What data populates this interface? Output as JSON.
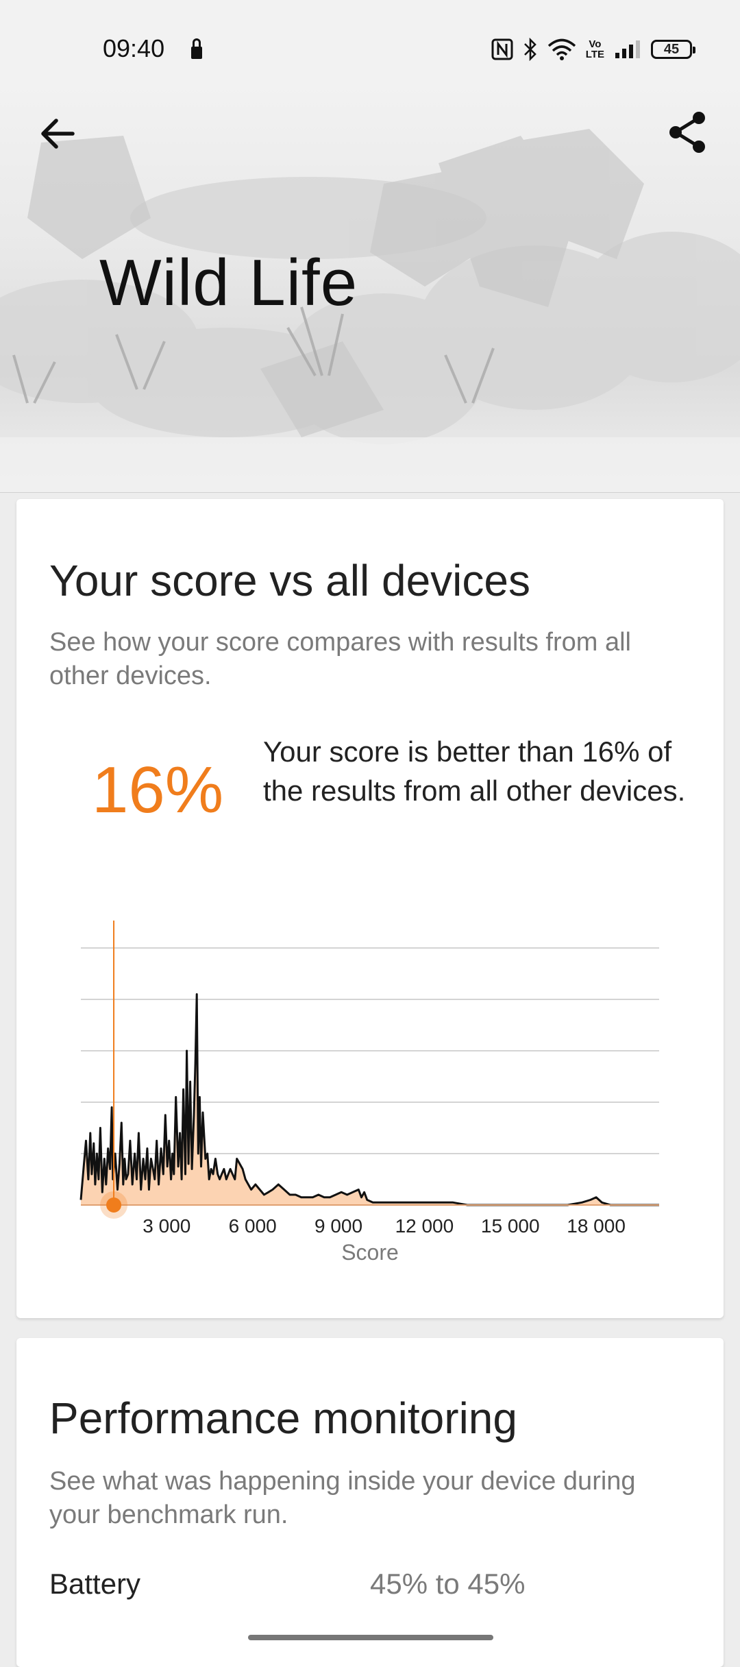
{
  "status_bar": {
    "time": "09:40",
    "volte": [
      "Vo",
      "LTE"
    ],
    "battery": "45",
    "icons": [
      "lock-icon",
      "nfc-icon",
      "bluetooth-icon",
      "wifi-icon",
      "volte-icon",
      "signal-icon",
      "battery-icon"
    ]
  },
  "hero": {
    "title": "Wild Life",
    "back_icon": "arrow-left-icon",
    "share_icon": "share-icon"
  },
  "score_card": {
    "title": "Your score vs all devices",
    "subtitle": "See how your score compares with results from all other devices.",
    "percent": "16%",
    "description": "Your score is better than 16% of the results from all other devices."
  },
  "chart_data": {
    "type": "area",
    "xlabel": "Score",
    "xlim": [
      0,
      20200
    ],
    "ylim": [
      0,
      100
    ],
    "grid": true,
    "x_tick_labels": [
      "3 000",
      "6 000",
      "9 000",
      "12 000",
      "15 000",
      "18 000"
    ],
    "x_ticks": [
      3000,
      6000,
      9000,
      12000,
      15000,
      18000
    ],
    "marker_score": 1150,
    "colors": {
      "fill": "#fcd3b2",
      "line": "#111111",
      "marker": "#f07d1c",
      "grid": "#c6c6c6"
    },
    "series": [
      {
        "x": [
          0,
          100,
          180,
          260,
          330,
          380,
          450,
          500,
          560,
          620,
          680,
          750,
          820,
          880,
          950,
          1020,
          1080,
          1120,
          1200,
          1280,
          1350,
          1420,
          1480,
          1530,
          1580,
          1650,
          1720,
          1800,
          1880,
          1950,
          2020,
          2100,
          2180,
          2250,
          2320,
          2380,
          2450,
          2520,
          2580,
          2650,
          2720,
          2800,
          2880,
          2950,
          3020,
          3080,
          3150,
          3200,
          3250,
          3320,
          3400,
          3460,
          3520,
          3580,
          3650,
          3700,
          3760,
          3820,
          3880,
          3950,
          4000,
          4050,
          4100,
          4150,
          4200,
          4260,
          4350,
          4420,
          4480,
          4550,
          4620,
          4700,
          4780,
          4850,
          4920,
          5000,
          5080,
          5150,
          5220,
          5300,
          5380,
          5450,
          5550,
          5650,
          5750,
          5850,
          5950,
          6100,
          6250,
          6400,
          6550,
          6700,
          6900,
          7100,
          7300,
          7500,
          7700,
          7900,
          8100,
          8300,
          8500,
          8700,
          8900,
          9100,
          9300,
          9500,
          9700,
          9800,
          9900,
          10000,
          10200,
          10500,
          11000,
          11500,
          12000,
          12500,
          13000,
          13500,
          14000,
          15000,
          16000,
          17000,
          17500,
          17800,
          18000,
          18200,
          18500,
          19000,
          20000,
          20200
        ],
        "y": [
          2,
          15,
          25,
          10,
          28,
          12,
          24,
          8,
          20,
          10,
          30,
          5,
          18,
          8,
          22,
          14,
          38,
          10,
          20,
          6,
          16,
          32,
          8,
          18,
          10,
          12,
          25,
          8,
          20,
          10,
          28,
          6,
          18,
          10,
          22,
          6,
          18,
          14,
          10,
          25,
          8,
          22,
          12,
          35,
          15,
          25,
          10,
          20,
          12,
          42,
          15,
          28,
          10,
          45,
          12,
          60,
          16,
          48,
          14,
          35,
          55,
          82,
          20,
          42,
          15,
          36,
          18,
          20,
          10,
          14,
          12,
          18,
          12,
          10,
          12,
          14,
          10,
          12,
          14,
          12,
          10,
          18,
          16,
          14,
          10,
          8,
          6,
          8,
          6,
          4,
          5,
          6,
          8,
          6,
          4,
          4,
          3,
          3,
          3,
          4,
          3,
          3,
          4,
          5,
          4,
          5,
          6,
          3,
          5,
          2,
          1,
          1,
          1,
          1,
          1,
          1,
          1,
          0,
          0,
          0,
          0,
          0,
          1,
          2,
          3,
          1,
          0,
          0,
          0,
          0
        ]
      }
    ]
  },
  "perf_card": {
    "title": "Performance monitoring",
    "subtitle": "See what was happening inside your device during your benchmark run.",
    "battery_label": "Battery",
    "battery_value": "45% to 45%"
  }
}
